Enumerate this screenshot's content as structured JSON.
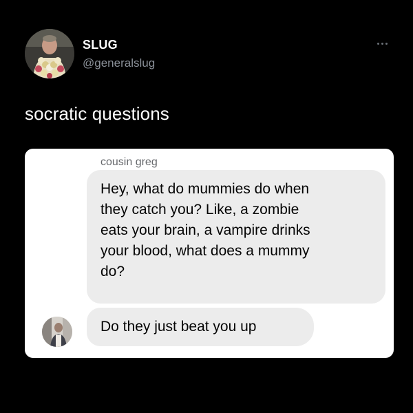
{
  "tweet": {
    "author": {
      "display_name": "SLUG",
      "handle": "@generalslug",
      "avatar": "profile-photo-with-flower-lei"
    },
    "more_icon": "ellipsis-icon",
    "text": "socratic questions"
  },
  "screenshot": {
    "sender_name": "cousin greg",
    "sender_avatar": "profile-photo",
    "messages": [
      "Hey, what do mummies do when\nthey catch you? Like, a zombie\neats your brain, a vampire drinks\nyour blood, what does a mummy\ndo?",
      "Do they just beat you up"
    ]
  },
  "colors": {
    "background": "#000000",
    "handle": "#8b9199",
    "card": "#ffffff",
    "bubble": "#ececec",
    "sender_name": "#65676b"
  }
}
